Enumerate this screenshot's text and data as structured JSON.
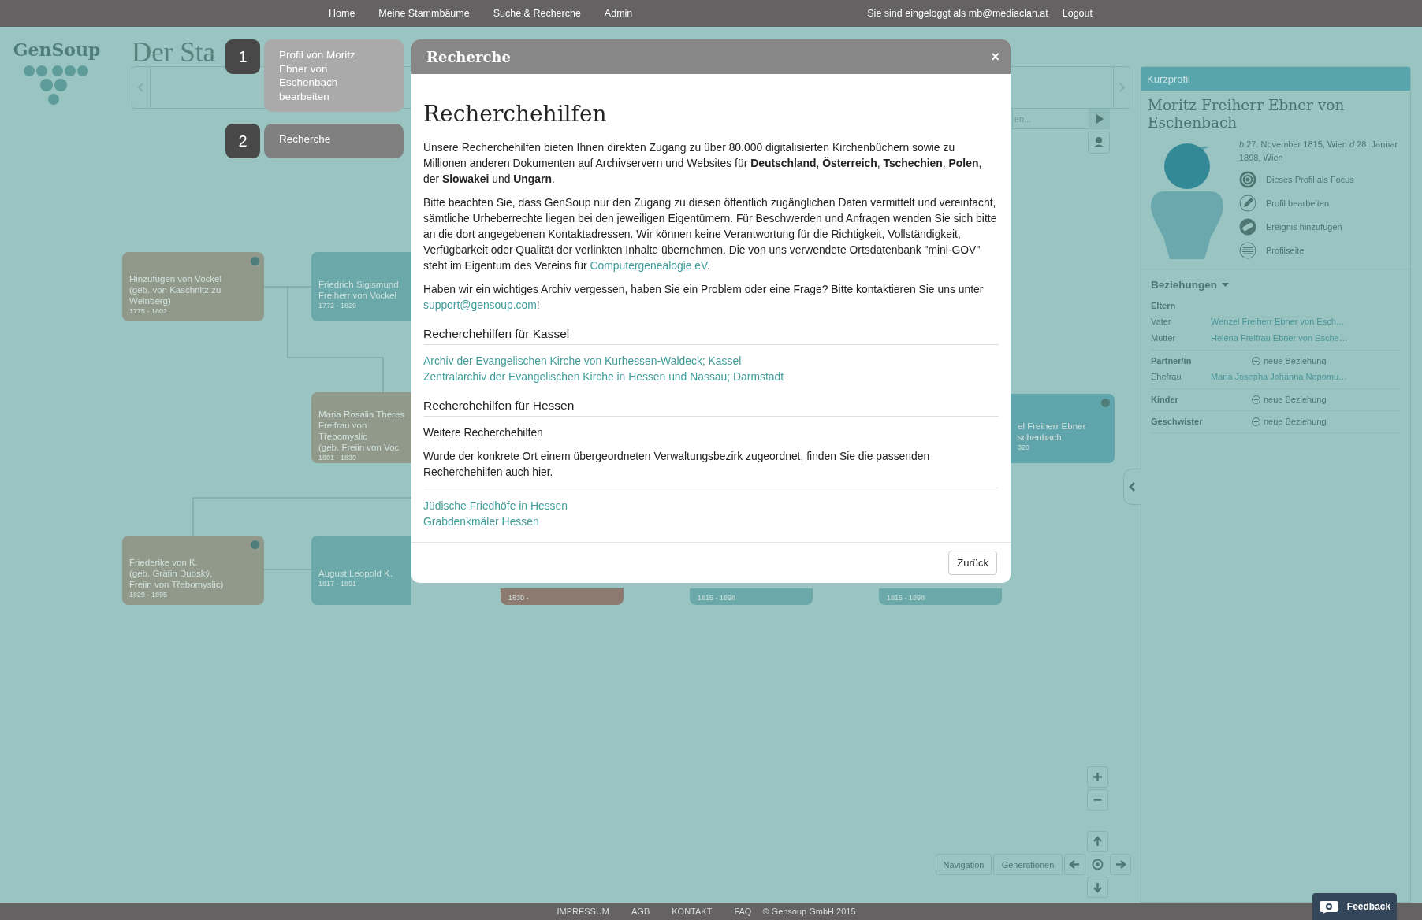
{
  "topbar": {
    "nav": [
      {
        "label": "Home"
      },
      {
        "label": "Meine Stammbäume"
      },
      {
        "label": "Suche & Recherche"
      },
      {
        "label": "Admin"
      }
    ],
    "login_text": "Sie sind eingeloggt als",
    "user": "mb@mediaclan.at",
    "logout": "Logout"
  },
  "logo": {
    "text": "GenSoup"
  },
  "page_title": "Der Sta",
  "search": {
    "placeholder": "en..."
  },
  "tour_steps": [
    {
      "number": "1",
      "text": "Profil von Moritz Ebner von Eschenbach bearbeiten",
      "selected": false
    },
    {
      "number": "2",
      "text": "Recherche",
      "selected": true
    }
  ],
  "tree": {
    "cards": [
      {
        "color": "#919a8a",
        "dot": true,
        "lines": [
          "Hinzufügen von Vockel",
          "(geb. von Kaschnitz zu",
          "Weinberg)"
        ],
        "years": "1775 - 1802"
      },
      {
        "color": "#6aa8aa",
        "dot": false,
        "lines": [
          "Friedrich Sigismund",
          "Freiherr von Vockel"
        ],
        "years": "1772 - 1829"
      },
      {
        "color": "#919a8a",
        "dot": false,
        "lines": [
          "Maria Rosalia Theres",
          "Freifrau von",
          "Třebomyslic",
          "(geb. Freiin von Voc"
        ],
        "years": "1801 - 1830"
      },
      {
        "color": "#919a8a",
        "dot": true,
        "lines": [
          "Friederike von K.",
          "(geb. Gräfin Dubský,",
          "Freiin von Třebomyslic)"
        ],
        "years": "1829 - 1895"
      },
      {
        "color": "#6aa8aa",
        "dot": false,
        "lines": [
          "August Leopold K."
        ],
        "years": "1817 - 1891"
      },
      {
        "color": "#8c7a70",
        "dot": false,
        "years": "1830 -"
      },
      {
        "color": "#6aa8aa",
        "dot": false,
        "years": "1815 - 1898"
      },
      {
        "color": "#6aa8aa",
        "dot": false,
        "years": "1815 - 1898"
      },
      {
        "color": "#5fa5ab",
        "dot": true,
        "lines": [
          "el Freiherr Ebner",
          "schenbach"
        ],
        "years": "320"
      }
    ]
  },
  "modal": {
    "title": "Recherche",
    "close": "×",
    "heading": "Recherchehilfen",
    "paragraphs": [
      [
        {
          "text": "Unsere Recherchehilfen bieten Ihnen direkten Zugang zu über 80.000 digitalisierten Kirchenbüchern sowie zu Millionen anderen Dokumenten auf Archivservern und Websites für **Deutschland**, **Österreich**, **Tschechien**, **Polen**, der **Slowakei** und **Ungarn**."
        }
      ],
      [
        {
          "text": "Bitte beachten Sie, dass GenSoup nur den Zugang zu diesen öffentlich zugänglichen Daten vermittelt und vereinfacht, sämtliche Urheberrechte liegen bei den jeweiligen Eigentümern. Für Beschwerden und Anfragen wenden Sie sich bitte an die dort angegebenen Kontaktadressen. Wir können keine Verantwortung für die Richtigkeit, Vollständigkeit, Verfügbarkeit oder Qualität der verlinkten Inhalte übernehmen. Die von uns verwendete Ortsdatenbank \"mini-GOV\" steht im Eigentum des Vereins für "
        },
        {
          "text": "Computergenealogie eV",
          "link": true
        },
        {
          "text": "."
        }
      ],
      [
        {
          "text": "Haben wir ein wichtiges Archiv vergessen, haben Sie ein Problem oder eine Frage? Bitte kontaktieren Sie uns unter "
        },
        {
          "text": "support@gensoup.com",
          "link": true
        },
        {
          "text": "!"
        }
      ]
    ],
    "sections": [
      {
        "heading": "Recherchehilfen für Kassel",
        "links": [
          "Archiv der Evangelischen Kirche von Kurhessen-Waldeck; Kassel",
          "Zentralarchiv der Evangelischen Kirche in Hessen und Nassau; Darmstadt"
        ]
      },
      {
        "heading": "Recherchehilfen für Hessen",
        "texts": [
          "Weitere Recherchehilfen",
          "Wurde der konkrete Ort einem übergeordneten Verwaltungsbezirk zugeordnet, finden Sie die passenden Recherchehilfen auch hier."
        ],
        "links": [
          "Jüdische Friedhöfe in Hessen",
          "Grabdenkmäler Hessen"
        ]
      }
    ],
    "button": "Zurück"
  },
  "profile": {
    "header": "Kurzprofil",
    "name": "Moritz Freiherr Ebner von Eschenbach",
    "life": "*b* 27. November 1815, Wien *d* 28. Januar 1898, Wien",
    "actions": [
      {
        "kind": "focus",
        "label": "Dieses Profil als Focus"
      },
      {
        "kind": "edit",
        "label": "Profil bearbeiten"
      },
      {
        "kind": "event",
        "label": "Ereignis hinzufügen"
      },
      {
        "kind": "page",
        "label": "Profilseite"
      }
    ],
    "relations": {
      "title": "Beziehungen",
      "groups": [
        {
          "label": "Eltern",
          "rows": [
            {
              "role": "Vater",
              "name": "Wenzel Freiherr Ebner von Esch…"
            },
            {
              "role": "Mutter",
              "name": "Helena Freifrau Ebner von Esche…"
            }
          ]
        },
        {
          "label": "Partner/in",
          "add": "neue Beziehung",
          "rows": [
            {
              "role": "Ehefrau",
              "name": "Maria Josepha Johanna Nepomu…"
            }
          ]
        },
        {
          "label": "Kinder",
          "add": "neue Beziehung"
        },
        {
          "label": "Geschwister",
          "add": "neue Beziehung"
        }
      ]
    }
  },
  "controls": {
    "buttons": [
      "Navigation",
      "Generationen"
    ]
  },
  "footer": {
    "links": [
      "IMPRESSUM",
      "AGB",
      "KONTAKT",
      "FAQ"
    ],
    "copyright": "© Gensoup GmbH 2015"
  },
  "feedback": {
    "label": "Feedback"
  }
}
